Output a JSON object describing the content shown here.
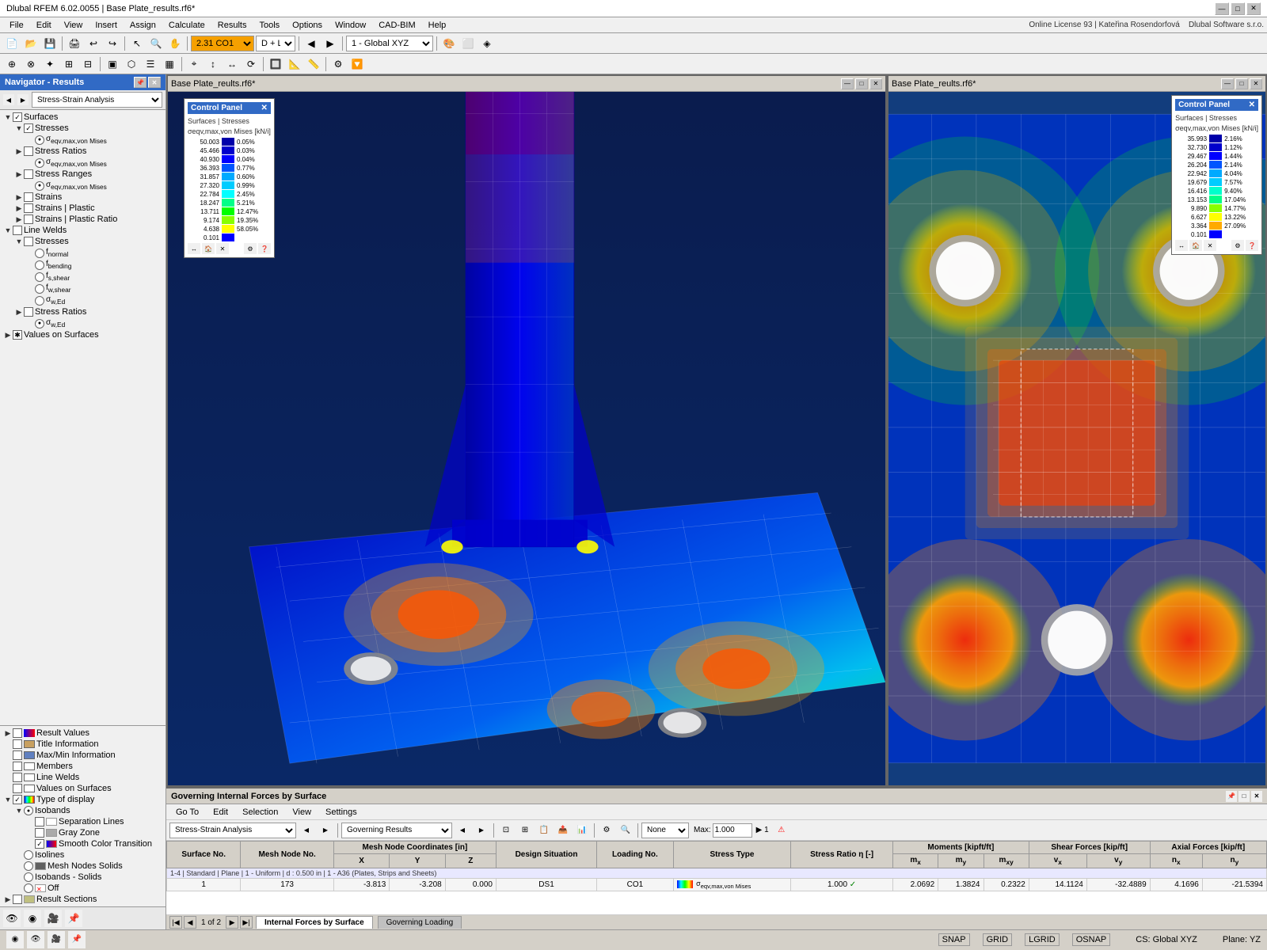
{
  "titlebar": {
    "text": "Dlubal RFEM 6.02.0055 | Base Plate_results.rf6*",
    "controls": [
      "—",
      "□",
      "✕"
    ]
  },
  "menubar": {
    "items": [
      "File",
      "Edit",
      "View",
      "Insert",
      "Assign",
      "Calculate",
      "Results",
      "Tools",
      "Options",
      "Window",
      "CAD-BIM",
      "Help"
    ]
  },
  "toolbar2": {
    "combo_co1": "2.31 CO1",
    "combo_dc": "D + L",
    "combo_xyz": "1 - Global XYZ"
  },
  "navigator": {
    "title": "Navigator - Results",
    "dropdown": "Stress-Strain Analysis",
    "tree": [
      {
        "label": "Surfaces",
        "level": 0,
        "type": "check",
        "checked": true,
        "expanded": true
      },
      {
        "label": "Stresses",
        "level": 1,
        "type": "check",
        "checked": true,
        "expanded": true
      },
      {
        "label": "σeqv,max,von Mises",
        "level": 2,
        "type": "radio",
        "checked": true
      },
      {
        "label": "Stress Ratios",
        "level": 1,
        "type": "check",
        "checked": false,
        "expanded": true
      },
      {
        "label": "σeqv,max,von Mises",
        "level": 2,
        "type": "radio",
        "checked": true
      },
      {
        "label": "Stress Ranges",
        "level": 1,
        "type": "check",
        "checked": false,
        "expanded": true
      },
      {
        "label": "σeqv,max,von Mises",
        "level": 2,
        "type": "radio",
        "checked": true
      },
      {
        "label": "Strains",
        "level": 1,
        "type": "check",
        "checked": false,
        "expanded": false
      },
      {
        "label": "Strains | Plastic",
        "level": 1,
        "type": "check",
        "checked": false,
        "expanded": false
      },
      {
        "label": "Strains | Plastic Ratio",
        "level": 1,
        "type": "check",
        "checked": false,
        "expanded": false
      },
      {
        "label": "Line Welds",
        "level": 0,
        "type": "check",
        "checked": false,
        "expanded": true
      },
      {
        "label": "Stresses",
        "level": 1,
        "type": "check",
        "checked": false,
        "expanded": true
      },
      {
        "label": "fnormal",
        "level": 2,
        "type": "radio",
        "checked": false
      },
      {
        "label": "fbending",
        "level": 2,
        "type": "radio",
        "checked": false
      },
      {
        "label": "fs,shear",
        "level": 2,
        "type": "radio",
        "checked": false
      },
      {
        "label": "fw,shear",
        "level": 2,
        "type": "radio",
        "checked": false
      },
      {
        "label": "σw,Ed",
        "level": 2,
        "type": "radio",
        "checked": false
      },
      {
        "label": "Stress Ratios",
        "level": 1,
        "type": "check",
        "checked": false,
        "expanded": false
      },
      {
        "label": "σw,Ed",
        "level": 2,
        "type": "radio",
        "checked": true
      },
      {
        "label": "Values on Surfaces",
        "level": 0,
        "type": "check",
        "checked": false,
        "expanded": false
      }
    ]
  },
  "nav_bottom": {
    "items": [
      {
        "label": "Result Values",
        "level": 0,
        "type": "check",
        "checked": false,
        "icon": "table"
      },
      {
        "label": "Title Information",
        "level": 0,
        "type": "check",
        "checked": false,
        "icon": "info"
      },
      {
        "label": "Max/Min Information",
        "level": 0,
        "type": "check",
        "checked": false,
        "icon": "info"
      },
      {
        "label": "Members",
        "level": 0,
        "type": "check",
        "checked": false,
        "icon": "line"
      },
      {
        "label": "Line Welds",
        "level": 0,
        "type": "check",
        "checked": false,
        "icon": "line"
      },
      {
        "label": "Values on Surfaces",
        "level": 0,
        "type": "check",
        "checked": false,
        "icon": "surface"
      },
      {
        "label": "Type of display",
        "level": 0,
        "type": "check",
        "checked": true,
        "expanded": true,
        "icon": "display"
      },
      {
        "label": "Isobands",
        "level": 1,
        "type": "radio",
        "checked": true,
        "expanded": true
      },
      {
        "label": "Separation Lines",
        "level": 2,
        "type": "check",
        "checked": false,
        "icon": "line"
      },
      {
        "label": "Gray Zone",
        "level": 2,
        "type": "check",
        "checked": false,
        "icon": "gray"
      },
      {
        "label": "Smooth Color Transition",
        "level": 2,
        "type": "check",
        "checked": true,
        "icon": "color"
      },
      {
        "label": "Isolines",
        "level": 1,
        "type": "radio",
        "checked": false
      },
      {
        "label": "Mesh Nodes Solids",
        "level": 1,
        "type": "radio",
        "checked": false,
        "icon": "mesh"
      },
      {
        "label": "Isobands - Solids",
        "level": 1,
        "type": "radio",
        "checked": false
      },
      {
        "label": "Off",
        "level": 1,
        "type": "radio",
        "checked": false
      }
    ]
  },
  "nav_bottom2": {
    "items": [
      {
        "label": "Result Sections",
        "level": 0,
        "type": "check",
        "checked": false,
        "icon": "section"
      }
    ]
  },
  "legend_left": {
    "title": "Control Panel",
    "subtitle": "Surfaces | Stresses",
    "subtitle2": "σeqv,max,von Mises [kN/i]",
    "values": [
      {
        "val": "50.003",
        "pct": "0.05%",
        "color": "#0000aa"
      },
      {
        "val": "45.466",
        "pct": "0.03%",
        "color": "#0000cc"
      },
      {
        "val": "40.930",
        "pct": "0.04%",
        "color": "#0000ff"
      },
      {
        "val": "36.393",
        "pct": "0.77%",
        "color": "#0055ff"
      },
      {
        "val": "31.857",
        "pct": "0.60%",
        "color": "#00aaff"
      },
      {
        "val": "27.320",
        "pct": "0.99%",
        "color": "#00ccff"
      },
      {
        "val": "22.784",
        "pct": "2.45%",
        "color": "#00ffff"
      },
      {
        "val": "18.247",
        "pct": "5.21%",
        "color": "#00ff88"
      },
      {
        "val": "13.711",
        "pct": "12.47%",
        "color": "#00ff00"
      },
      {
        "val": "9.174",
        "pct": "19.35%",
        "color": "#88ff00"
      },
      {
        "val": "4.638",
        "pct": "58.05%",
        "color": "#ffff00"
      },
      {
        "val": "0.101",
        "pct": "",
        "color": "#0000ff"
      }
    ]
  },
  "legend_right": {
    "title": "Control Panel",
    "subtitle": "Surfaces | Stresses",
    "subtitle2": "σeqv,max,von Mises [kN/i]",
    "values": [
      {
        "val": "35.993",
        "pct": "2.16%",
        "color": "#0000aa"
      },
      {
        "val": "32.730",
        "pct": "1.12%",
        "color": "#0000cc"
      },
      {
        "val": "29.467",
        "pct": "1.44%",
        "color": "#0000ff"
      },
      {
        "val": "26.204",
        "pct": "2.14%",
        "color": "#0055ff"
      },
      {
        "val": "22.942",
        "pct": "4.04%",
        "color": "#00aaff"
      },
      {
        "val": "19.679",
        "pct": "7.57%",
        "color": "#00ccff"
      },
      {
        "val": "16.416",
        "pct": "9.40%",
        "color": "#00ffcc"
      },
      {
        "val": "13.153",
        "pct": "17.04%",
        "color": "#00ff88"
      },
      {
        "val": "9.890",
        "pct": "14.77%",
        "color": "#88ff00"
      },
      {
        "val": "6.627",
        "pct": "13.22%",
        "color": "#ffff00"
      },
      {
        "val": "3.364",
        "pct": "27.09%",
        "color": "#ffaa00"
      },
      {
        "val": "0.101",
        "pct": "",
        "color": "#0000ff"
      }
    ]
  },
  "viewport_left_title": "Base Plate_reults.rf6*",
  "viewport_right_title": "Base Plate_reults.rf6*",
  "results_panel": {
    "title": "Governing Internal Forces by Surface",
    "menu": [
      "Go To",
      "Edit",
      "Selection",
      "View",
      "Settings"
    ],
    "combo_analysis": "Stress-Strain Analysis",
    "combo_results": "Governing Results",
    "combo_none": "None",
    "combo_max": "Max:",
    "max_val": "1.000",
    "page_info": "1 of 2",
    "tab_internal": "Internal Forces by Surface",
    "tab_governing": "Governing Loading",
    "table": {
      "headers": [
        "Surface No.",
        "Mesh Node No.",
        "Mesh Node Coordinates [in]",
        "",
        "",
        "Design Situation",
        "Loading No.",
        "Stress Type",
        "Stress Ratio η [-]",
        "Moments [kipft/ft]",
        "",
        "",
        "Shear Forces [kip/ft]",
        "",
        "Axial Forces [kip/ft]",
        ""
      ],
      "subheaders": [
        "",
        "",
        "X",
        "Y",
        "Z",
        "",
        "",
        "",
        "",
        "mx",
        "my",
        "mxy",
        "vx",
        "vy",
        "nx",
        "ny"
      ],
      "row1_info": "1-4 | Standard | Plane | 1 - Uniform | d : 0.500 in | 1 - A36 (Plates, Strips and Sheets)",
      "rows": [
        {
          "surface": "1",
          "mesh_node": "173",
          "x": "-3.813",
          "y": "-3.208",
          "z": "0.000",
          "design_sit": "DS1",
          "loading": "CO1",
          "stress_type": "σeqv,max,von Mises",
          "ratio": "1.000",
          "ratio_check": "✓",
          "mx": "2.0692",
          "my": "1.3824",
          "mxy": "0.2322",
          "vx": "14.1124",
          "vy": "-32.4889",
          "nx": "4.1696",
          "ny": "-21.5394"
        }
      ]
    }
  },
  "statusbar": {
    "snap": "SNAP",
    "grid": "GRID",
    "lgrid": "LGRID",
    "osnap": "OSNAP",
    "cs": "CS: Global XYZ",
    "plane": "Plane: YZ"
  }
}
